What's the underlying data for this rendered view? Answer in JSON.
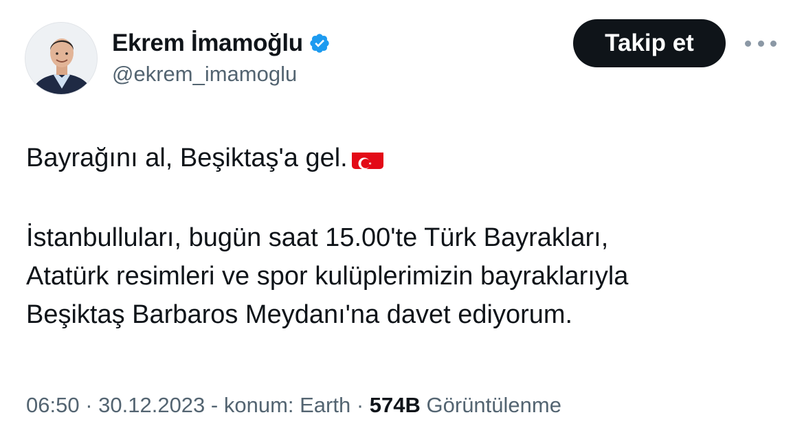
{
  "author": {
    "display_name": "Ekrem İmamoğlu",
    "handle": "@ekrem_imamoglu",
    "verified_icon": "verified-badge-icon"
  },
  "actions": {
    "follow_label": "Takip et",
    "more_icon": "more-horizontal-icon"
  },
  "tweet": {
    "line1": "Bayrağını al, Beşiktaş'a gel.",
    "flag_emoji": "turkey-flag-icon",
    "paragraph2": [
      "İstanbulluları, bugün saat 15.00'te Türk Bayrakları,",
      "Atatürk resimleri ve spor kulüplerimizin bayraklarıyla",
      "Beşiktaş Barbaros Meydanı'na davet ediyorum."
    ]
  },
  "meta": {
    "time": "06:50",
    "sep1": " · ",
    "date": "30.12.2023",
    "sep2": " - ",
    "location": "konum: Earth",
    "sep3": " · ",
    "views_count": "574B",
    "views_label": " Görüntülenme"
  },
  "colors": {
    "text_primary": "#0f1419",
    "text_secondary": "#536471",
    "verified_blue": "#1d9bf0",
    "flag_red": "#e30a17",
    "button_bg": "#0f1419"
  }
}
